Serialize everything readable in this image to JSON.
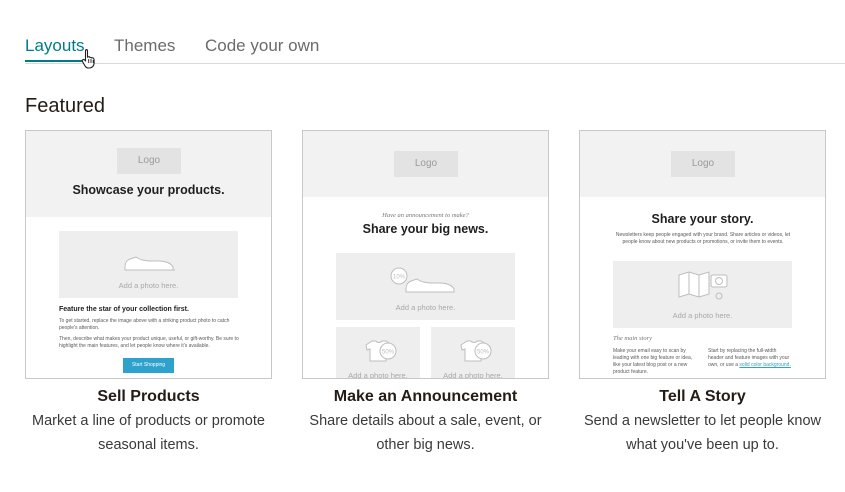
{
  "tabs": [
    {
      "label": "Layouts",
      "active": true
    },
    {
      "label": "Themes",
      "active": false
    },
    {
      "label": "Code your own",
      "active": false
    }
  ],
  "section_title": "Featured",
  "cards": [
    {
      "title": "Sell Products",
      "description": "Market a line of products or promote seasonal items.",
      "preview": {
        "logo": "Logo",
        "headline": "Showcase your products.",
        "photo_label": "Add a photo here.",
        "subhead": "Feature the star of your collection first.",
        "body1": "To get started, replace the image above with a striking product photo to catch people's attention.",
        "body2": "Then, describe what makes your product unique, useful, or gift-worthy. Be sure to highlight the main features, and let people know where it's available.",
        "button": "Start Shopping"
      }
    },
    {
      "title": "Make an Announcement",
      "description": "Share details about a sale, event, or other big news.",
      "preview": {
        "logo": "Logo",
        "kicker": "Have an announcement to make?",
        "headline": "Share your big news.",
        "photo_label": "Add a photo here.",
        "photo_label_2": "Add a photo here.",
        "photo_label_3": "Add a photo here.",
        "tag1": "10%",
        "tag2": "50%",
        "tag3": "50%"
      }
    },
    {
      "title": "Tell A Story",
      "description": "Send a newsletter to let people know what you've been up to.",
      "preview": {
        "logo": "Logo",
        "headline": "Share your story.",
        "intro": "Newsletters keep people engaged with your brand. Share articles or videos, let people know about new products or promotions, or invite them to events.",
        "photo_label": "Add a photo here.",
        "story_label": "The main story",
        "col1": "Make your email easy to scan by leading with one big feature or idea, like your latest blog post or a new product feature.",
        "col2": "Start by replacing the full-width header and feature images with your own, or use a",
        "col2_link": "solid color background."
      }
    }
  ],
  "colors": {
    "accent": "#007c89",
    "button": "#2ea2cc"
  }
}
